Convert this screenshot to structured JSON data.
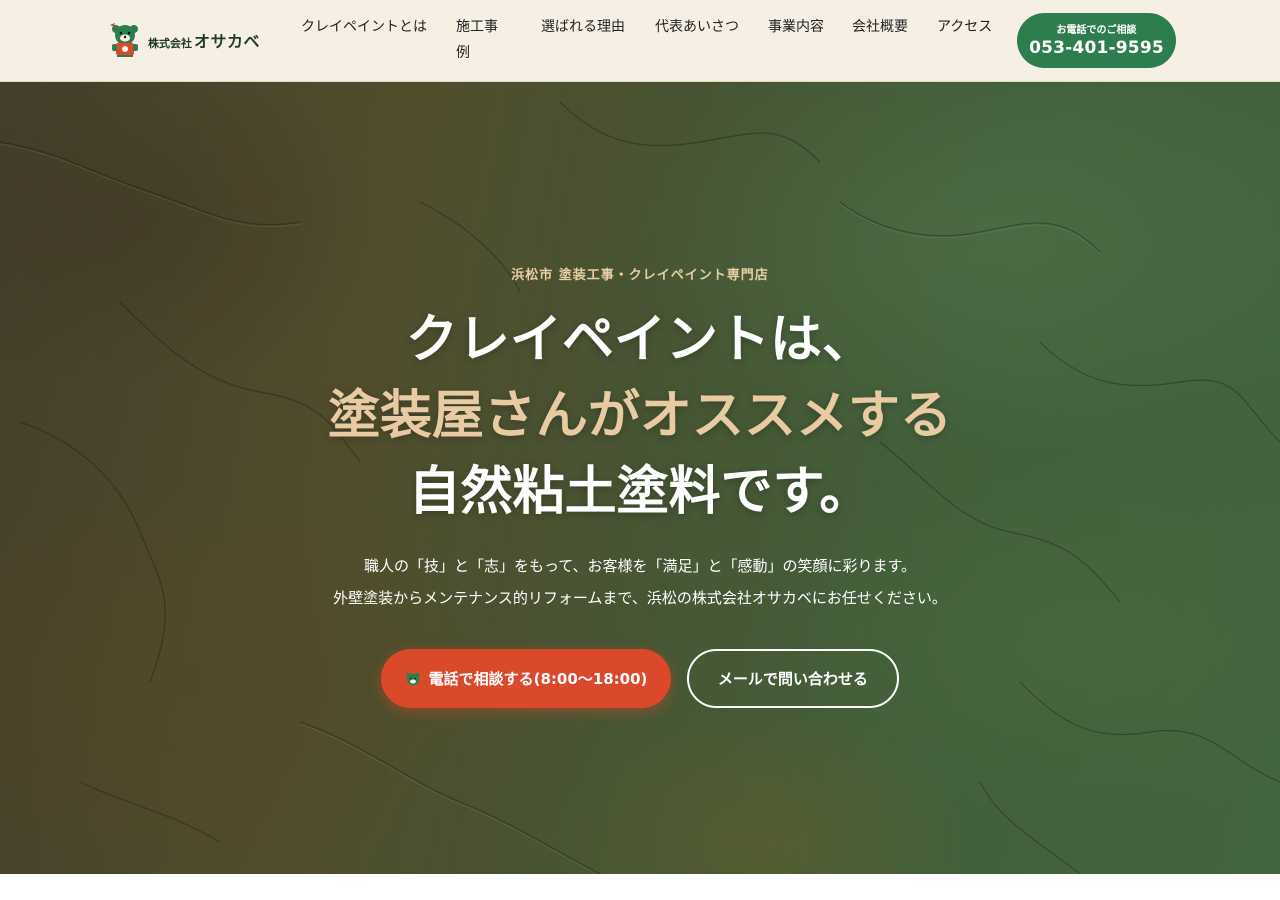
{
  "header": {
    "logo": {
      "company_prefix": "株式会社",
      "company_name": "オサカベ"
    },
    "nav": [
      {
        "label": "クレイペイントとは"
      },
      {
        "label": "施工事例"
      },
      {
        "label": "選ばれる理由"
      },
      {
        "label": "代表あいさつ"
      },
      {
        "label": "事業内容"
      },
      {
        "label": "会社概要"
      },
      {
        "label": "アクセス"
      }
    ],
    "tel_button": {
      "label": "お電話でのご相談",
      "number": "053-401-9595"
    }
  },
  "hero": {
    "eyebrow": "浜松市 塗装工事・クレイペイント専門店",
    "headline": [
      "クレイペイントは、",
      "塗装屋さんがオススメする",
      "自然粘土塗料です。"
    ],
    "description": [
      "職人の「技」と「志」をもって、お客様を「満足」と「感動」の笑顔に彩ります。",
      "外壁塗装からメンテナンス的リフォームまで、浜松の株式会社オサカベにお任せください。"
    ],
    "cta_phone": {
      "label": "電話で相談する(8:00〜18:00)",
      "icon": "bear-mascot-icon"
    },
    "cta_mail": {
      "label": "メールで問い合わせる"
    }
  },
  "colors": {
    "header_bg": "#f6efe4",
    "brand_green": "#2e7d4f",
    "cta_red": "#d9492a",
    "headline_accent": "#e8cba3"
  }
}
